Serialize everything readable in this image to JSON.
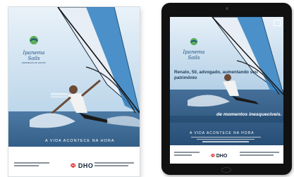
{
  "ad": {
    "brand_name": "Ipanema Sails",
    "brand_sub": "EMPRESAS DO GRUPO",
    "caption": "A VIDA ACONTECE NA HORA",
    "footer_logo": "DHO",
    "footer_logo_mark": "Φ"
  },
  "tablet": {
    "brand_name": "Ipanema Sails",
    "headline": "Renato, 50, advogado, aumentando seu patrimônio",
    "tagline": "de momentos inesquecíveis.",
    "caption": "A VIDA ACONTECE NA HORA",
    "footer_logo": "DHO",
    "footer_logo_mark": "Φ"
  },
  "colors": {
    "sky": "#cfe3f2",
    "sea": "#2e5a86",
    "brand_blue": "#1c4f7e",
    "logo_green": "#5cae5a"
  }
}
